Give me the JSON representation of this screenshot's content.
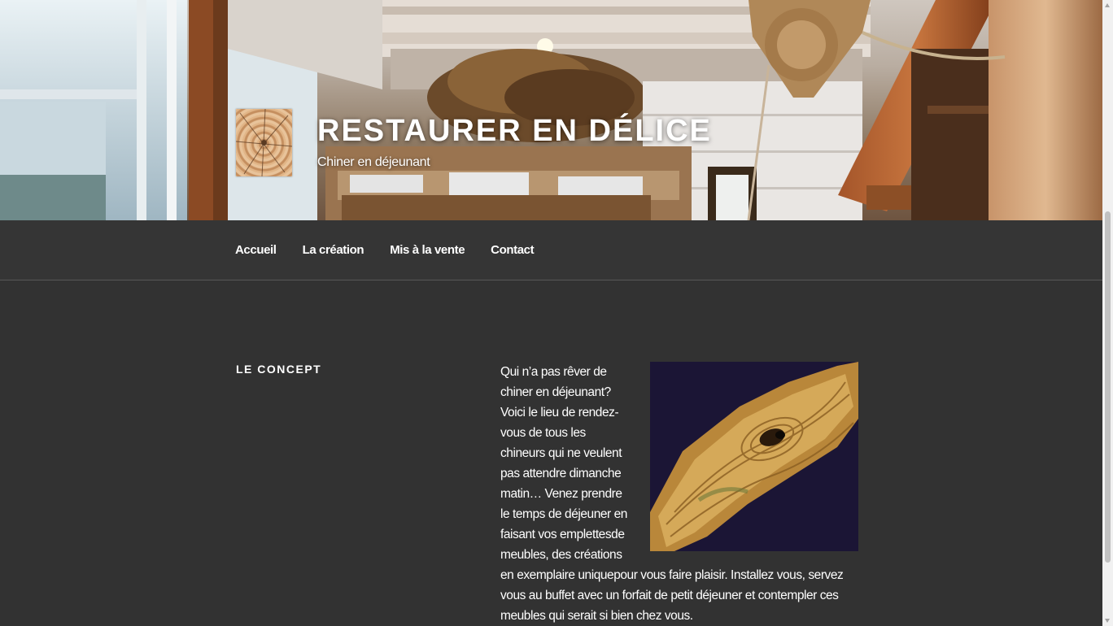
{
  "site": {
    "title": "RESTAURER EN DÉLICE",
    "tagline": "Chiner en déjeunant"
  },
  "nav": {
    "items": [
      {
        "label": "Accueil"
      },
      {
        "label": "La création"
      },
      {
        "label": "Mis à la vente"
      },
      {
        "label": "Contact"
      }
    ]
  },
  "section": {
    "title": "LE CONCEPT",
    "body": "Qui n’a pas rêver de chiner en déjeunant? Voici le lieu de rendez-vous de tous les chineurs qui ne veulent pas attendre dimanche matin… Venez prendre le temps de déjeuner en faisant vos emplettesde meubles, des créations en exemplaire uniquepour vous faire plaisir. Installez vous, servez vous au buffet avec un forfait de petit déjeuner et contempler ces meubles qui serait si bien chez vous."
  },
  "colors": {
    "background": "#323232",
    "nav_background": "#353535",
    "text": "#ffffff"
  },
  "icons": {
    "logo": "wood-slice-logo",
    "content_image": "olive-wood-board-image"
  }
}
